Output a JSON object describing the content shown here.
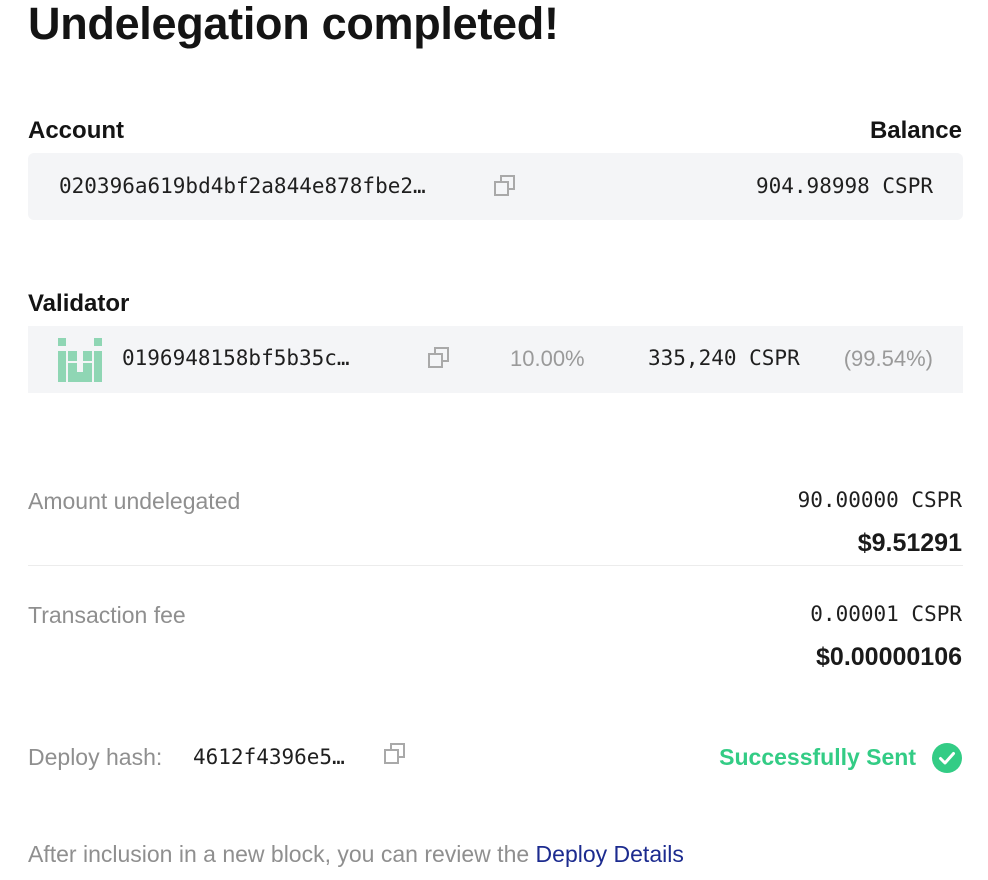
{
  "page": {
    "title": "Undelegation completed!"
  },
  "account": {
    "label": "Account",
    "balance_label": "Balance",
    "hash": "020396a619bd4bf2a844e878fbe2…",
    "balance": "904.98998 CSPR"
  },
  "validator": {
    "label": "Validator",
    "hash": "0196948158bf5b35c…",
    "fee": "10.00%",
    "stake": "335,240 CSPR",
    "share": "(99.54%)"
  },
  "amount": {
    "label": "Amount undelegated",
    "cspr": "90.00000 CSPR",
    "usd": "$9.51291"
  },
  "tx_fee": {
    "label": "Transaction fee",
    "cspr": "0.00001 CSPR",
    "usd": "$0.00000106"
  },
  "deploy": {
    "label": "Deploy hash:",
    "hash": "4612f4396e5…",
    "status": "Successfully Sent"
  },
  "footer": {
    "text": "After inclusion in a new block, you can review the ",
    "link": "Deploy Details"
  },
  "colors": {
    "success": "#33cc85",
    "link": "#1c2b8f",
    "avatar": "#8fd6b4"
  },
  "icons": {
    "copy": "copy-icon",
    "status": "check-circle-icon",
    "validator_avatar": "validator-identicon"
  }
}
